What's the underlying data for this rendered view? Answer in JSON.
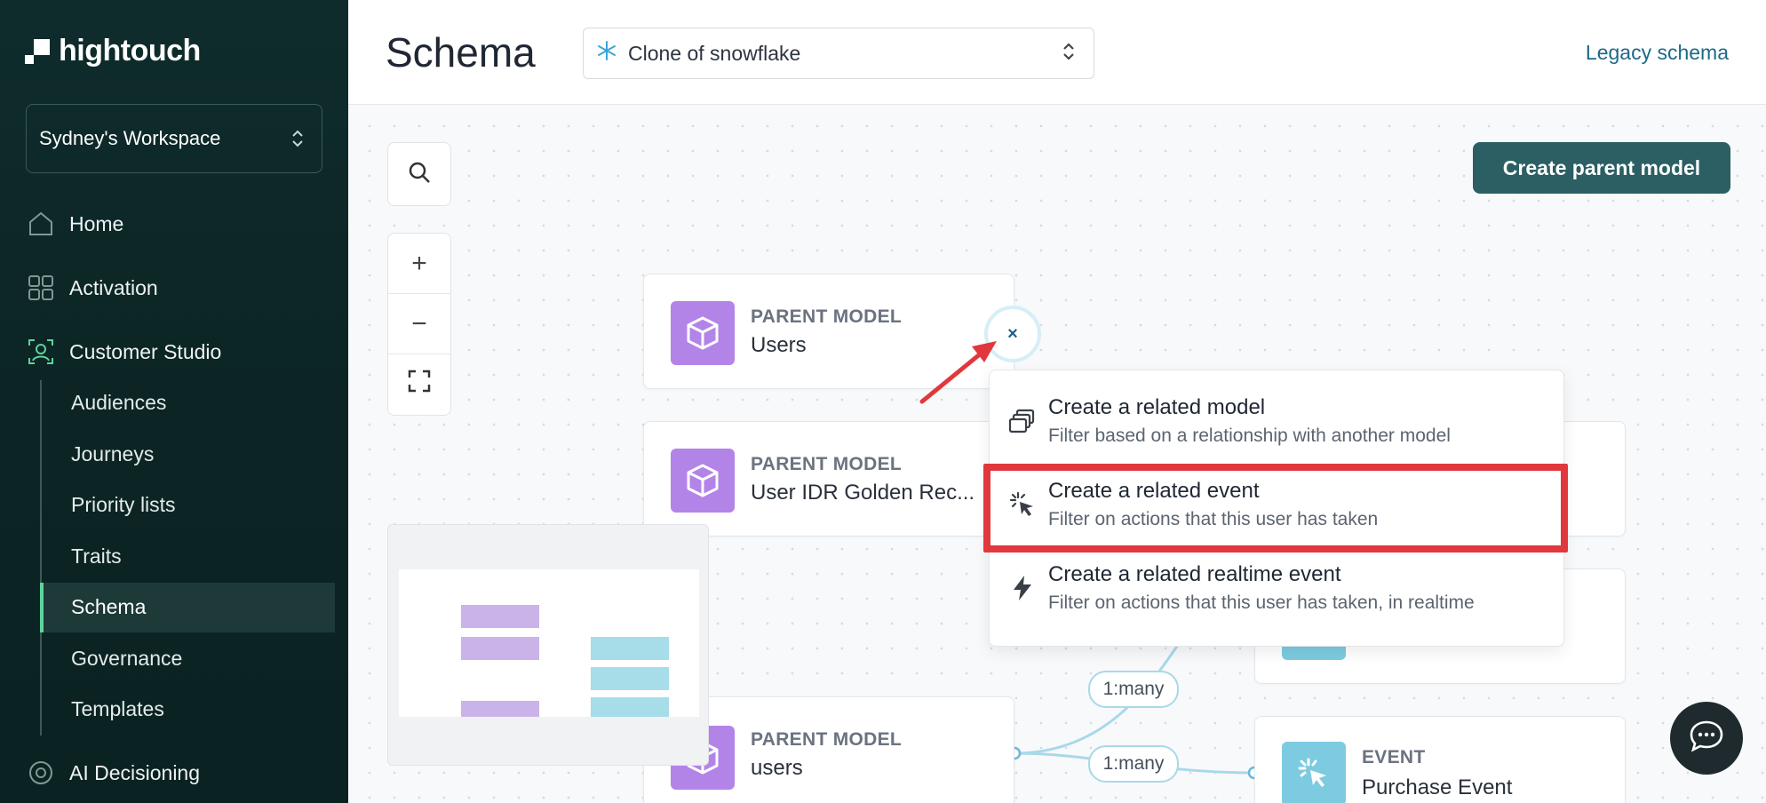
{
  "brand": {
    "name": "hightouch"
  },
  "workspace": {
    "name": "Sydney's Workspace"
  },
  "sidebar": {
    "items": [
      {
        "label": "Home",
        "icon": "home-icon"
      },
      {
        "label": "Activation",
        "icon": "grid-icon"
      },
      {
        "label": "Customer Studio",
        "icon": "user-frame-icon"
      },
      {
        "label": "AI Decisioning",
        "icon": "ai-icon"
      }
    ],
    "sub_items": [
      "Audiences",
      "Journeys",
      "Priority lists",
      "Traits",
      "Schema",
      "Governance",
      "Templates"
    ],
    "active": "Schema"
  },
  "header": {
    "title": "Schema",
    "source": "Clone of snowflake",
    "legacy_link": "Legacy schema"
  },
  "toolbar": {
    "create_parent": "Create parent model"
  },
  "nodes": [
    {
      "kind": "PARENT MODEL",
      "name": "Users"
    },
    {
      "kind": "PARENT MODEL",
      "name": "User IDR Golden Rec..."
    },
    {
      "kind": "PARENT MODEL",
      "name": "users"
    },
    {
      "kind": "EVENT",
      "name": "Purchase Event"
    }
  ],
  "close_label": "×",
  "menu": {
    "items": [
      {
        "title": "Create a related model",
        "subtitle": "Filter based on a relationship with another model",
        "icon": "stack-icon"
      },
      {
        "title": "Create a related event",
        "subtitle": "Filter on actions that this user has taken",
        "icon": "click-icon"
      },
      {
        "title": "Create a related realtime event",
        "subtitle": "Filter on actions that this user has taken, in realtime",
        "icon": "bolt-icon"
      }
    ]
  },
  "edges": [
    "1:many",
    "1:many"
  ],
  "colors": {
    "accent": "#2b5f63",
    "highlight": "#e0383d",
    "parent_badge": "#b384e8",
    "event_badge": "#7ccbe0"
  }
}
